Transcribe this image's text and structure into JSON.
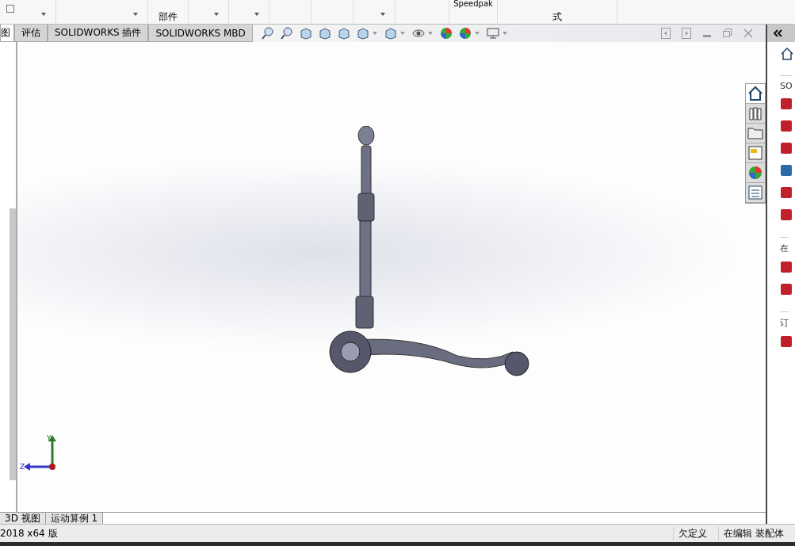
{
  "ribbon": {
    "labels": [
      {
        "text": "部件"
      },
      {
        "text": "Speedpak"
      },
      {
        "text": "式"
      }
    ]
  },
  "command_tabs": [
    {
      "label": "图",
      "selected": true
    },
    {
      "label": "评估",
      "selected": false
    },
    {
      "label": "SOLIDWORKS 插件",
      "selected": false
    },
    {
      "label": "SOLIDWORKS MBD",
      "selected": false
    }
  ],
  "triad": {
    "y_label": "Y",
    "z_label": "Z"
  },
  "task_pane": {
    "sections": [
      "SO",
      "在",
      "订"
    ]
  },
  "bottom_tabs": [
    {
      "label": "3D 视图",
      "selected": false
    },
    {
      "label": "运动算例 1",
      "selected": false
    }
  ],
  "status_bar": {
    "version": "2018 x64 版",
    "state": "欠定义",
    "mode": "在编辑 装配体"
  }
}
